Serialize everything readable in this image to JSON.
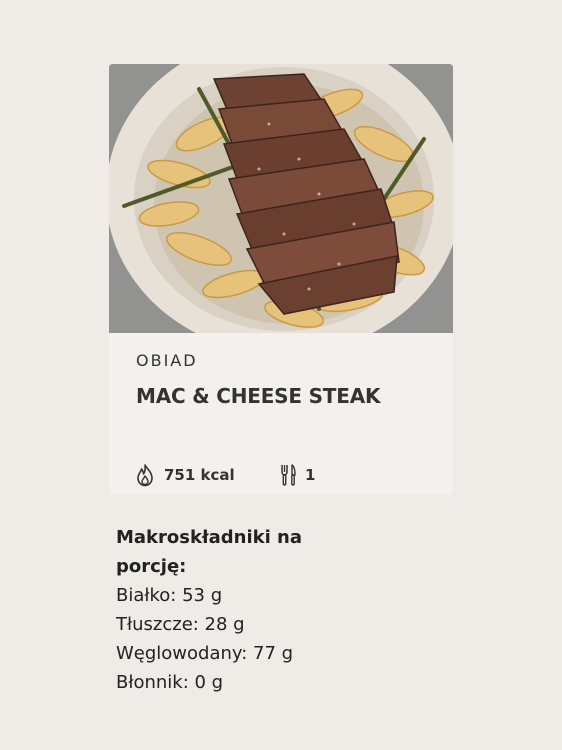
{
  "recipe": {
    "category": "OBIAD",
    "title": "MAC & CHEESE STEAK",
    "calories": "751 kcal",
    "servings": "1",
    "photo_alt": "steak-on-pasta-photo"
  },
  "macros": {
    "heading": "Makroskładniki na porcję:",
    "protein": "Białko: 53 g",
    "fat": "Tłuszcze: 28 g",
    "carbs": "Węglowodany: 77 g",
    "fiber": "Błonnik: 0 g"
  },
  "icons": {
    "calories": "flame-icon",
    "servings": "fork-knife-icon"
  },
  "colors": {
    "background": "#efebe6",
    "card": "#f3f0ee",
    "text": "#333333"
  }
}
